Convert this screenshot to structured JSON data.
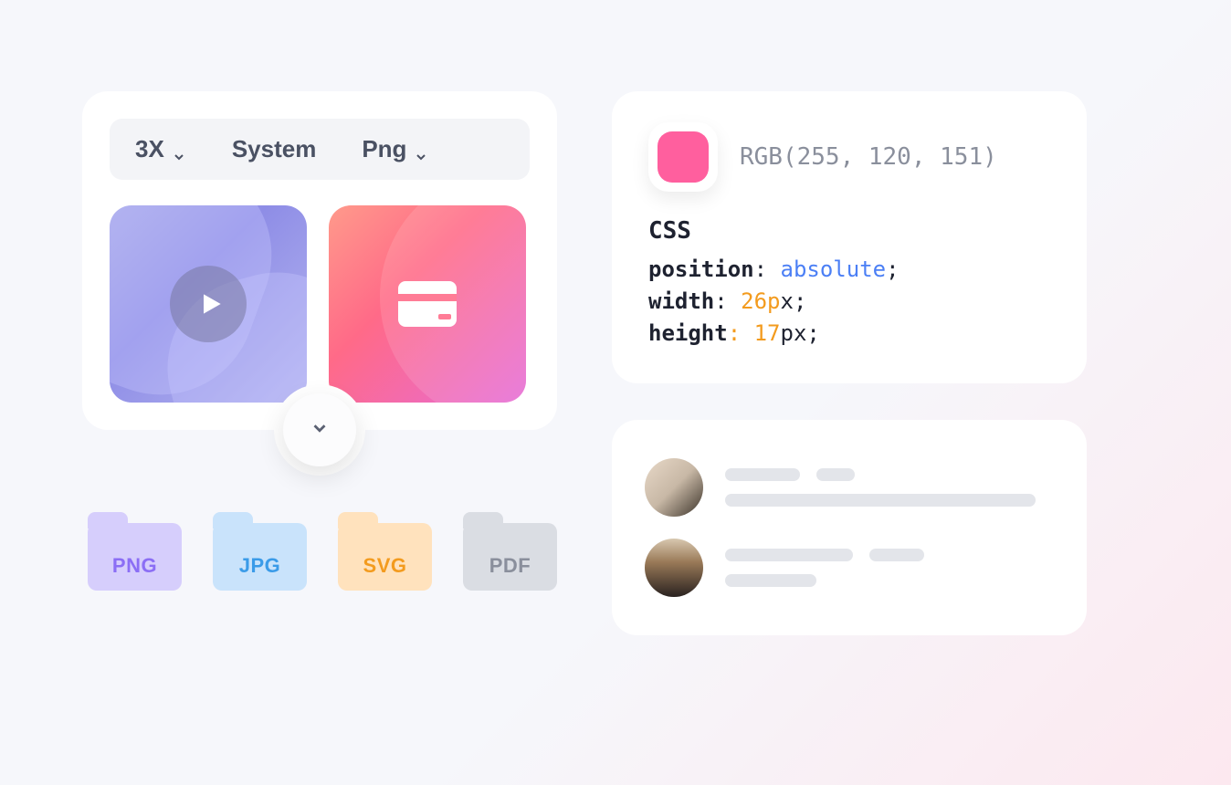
{
  "toolbar": {
    "scale_label": "3X",
    "system_label": "System",
    "format_label": "Png"
  },
  "thumbnails": [
    {
      "kind": "video",
      "icon": "play-icon"
    },
    {
      "kind": "card",
      "icon": "credit-card-icon"
    }
  ],
  "folders": [
    {
      "label": "PNG",
      "class": "png"
    },
    {
      "label": "JPG",
      "class": "jpg"
    },
    {
      "label": "SVG",
      "class": "svg"
    },
    {
      "label": "PDF",
      "class": "pdf"
    }
  ],
  "color_inspector": {
    "swatch_hex": "#ff5f9e",
    "rgb_text": "RGB(255, 120, 151)",
    "css_heading": "CSS",
    "lines": {
      "l1_prop": "position",
      "l1_val": "absolute",
      "l2_prop": "width",
      "l2_val_num": "26p",
      "l2_val_rest": "x",
      "l3_prop": "height",
      "l3_val_num": "17",
      "l3_val_rest": "px"
    }
  },
  "users": [
    {
      "avatar": "a1"
    },
    {
      "avatar": "a2"
    }
  ]
}
